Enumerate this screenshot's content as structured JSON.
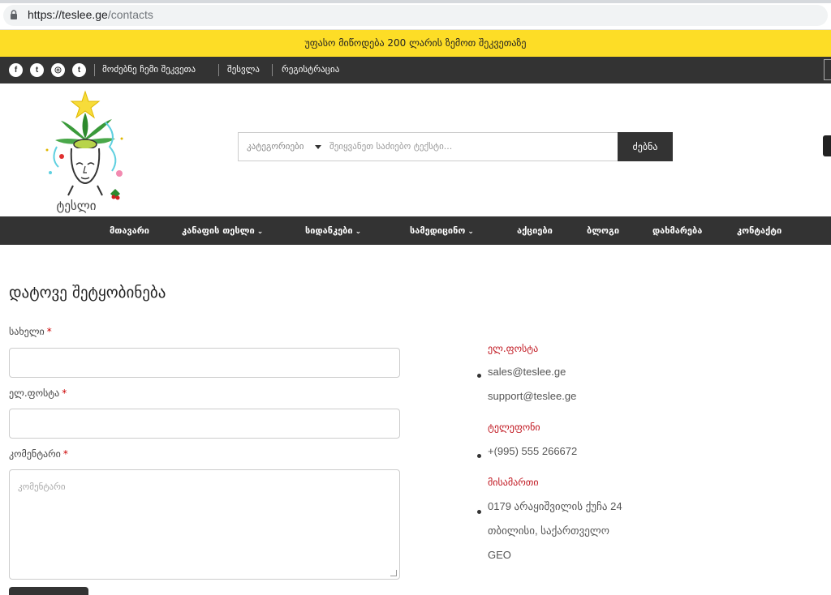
{
  "browser": {
    "url_host": "https://teslee.ge",
    "url_path": "/contacts"
  },
  "promo": {
    "text": "უფასო მიწოდება 200 ლარის ზემოთ შეკვეთაზე"
  },
  "topbar": {
    "social": [
      {
        "icon": "facebook-icon",
        "glyph": "f"
      },
      {
        "icon": "twitter-icon",
        "glyph": "t"
      },
      {
        "icon": "instagram-icon",
        "glyph": "◎"
      },
      {
        "icon": "tumblr-icon",
        "glyph": "t"
      }
    ],
    "links": [
      "მოძებნე ჩემი შეკვეთა",
      "შესვლა",
      "რეგისტრაცია"
    ]
  },
  "header": {
    "logo_text": "ტესლი",
    "search": {
      "category_label": "კატეგორიები",
      "placeholder": "შეიყვანეთ საძიებო ტექსტი...",
      "button_label": "ძებნა"
    }
  },
  "nav": {
    "items": [
      {
        "label": "მთავარი",
        "dropdown": false
      },
      {
        "label": "კანაფის თესლი",
        "dropdown": true
      },
      {
        "label": "სიდანკები",
        "dropdown": true
      },
      {
        "label": "სამედიცინო",
        "dropdown": true
      },
      {
        "label": "აქციები",
        "dropdown": false
      },
      {
        "label": "ბლოგი",
        "dropdown": false
      },
      {
        "label": "დახმარება",
        "dropdown": false
      },
      {
        "label": "კონტაქტი",
        "dropdown": false
      }
    ]
  },
  "form": {
    "title": "დატოვე შეტყობინება",
    "name_label": "სახელი",
    "email_label": "ელ.ფოსტა",
    "comment_label": "კომენტარი",
    "required_mark": "*",
    "comment_placeholder": "კომენტარი"
  },
  "contact": {
    "email_heading": "ელ.ფოსტა",
    "emails": [
      "sales@teslee.ge",
      "support@teslee.ge"
    ],
    "phone_heading": "ტელეფონი",
    "phone": "+(995) 555 266672",
    "address_heading": "მისამართი",
    "address_lines": [
      "0179 არაყიშვილის ქუჩა 24",
      "თბილისი, საქართველო",
      "GEO"
    ]
  },
  "colors": {
    "promo_bg": "#fddd26",
    "dark_bar": "#333333",
    "accent_red": "#c0161f"
  }
}
